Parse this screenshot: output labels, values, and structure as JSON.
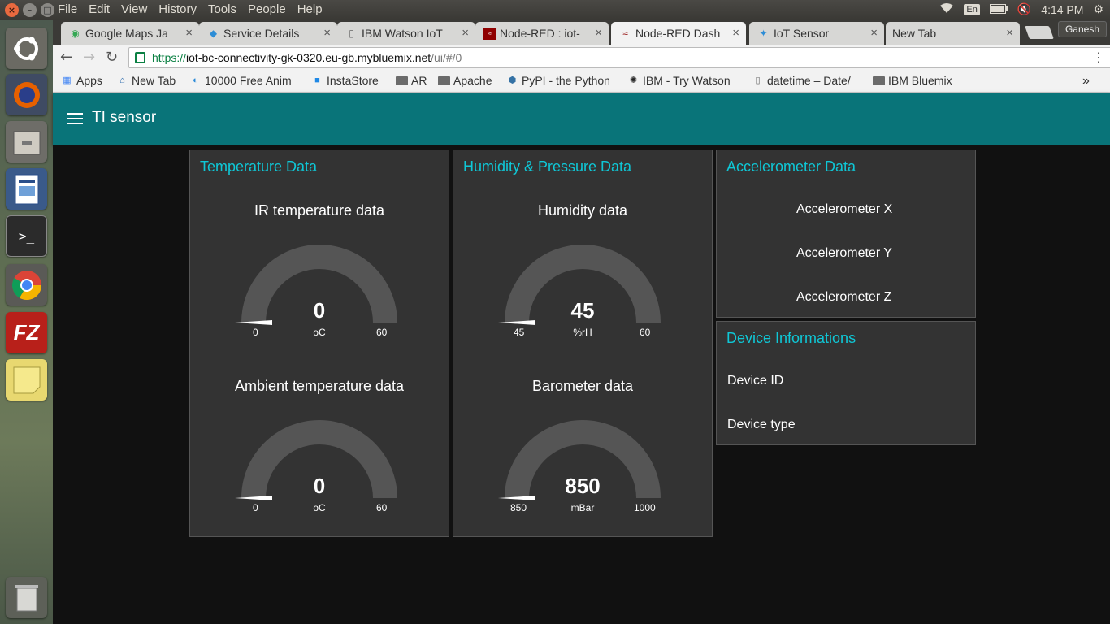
{
  "system": {
    "menus": [
      "File",
      "Edit",
      "View",
      "History",
      "Tools",
      "People",
      "Help"
    ],
    "language": "En",
    "time": "4:14 PM",
    "profile": "Ganesh"
  },
  "tabs": [
    {
      "label": "Google Maps Ja",
      "icon": "google-maps-icon"
    },
    {
      "label": "Service Details",
      "icon": "bluemix-icon"
    },
    {
      "label": "IBM Watson IoT",
      "icon": "page-icon"
    },
    {
      "label": "Node-RED : iot-",
      "icon": "node-red-icon"
    },
    {
      "label": "Node-RED Dash",
      "icon": "node-red-icon"
    },
    {
      "label": "IoT Sensor",
      "icon": "iot-icon"
    },
    {
      "label": "New Tab",
      "icon": ""
    }
  ],
  "omnibox": {
    "scheme": "https://",
    "host": "iot-bc-connectivity-gk-0320.eu-gb.mybluemix.net",
    "path": "/ui/#/0"
  },
  "bookmarks": [
    {
      "label": "Apps"
    },
    {
      "label": "New Tab"
    },
    {
      "label": "10000 Free Anim"
    },
    {
      "label": "InstaStore"
    },
    {
      "label": "AR"
    },
    {
      "label": "Apache"
    },
    {
      "label": "PyPI - the Python"
    },
    {
      "label": "IBM - Try Watson"
    },
    {
      "label": "datetime – Date/"
    },
    {
      "label": "IBM Bluemix"
    }
  ],
  "dashboard": {
    "title": "TI sensor",
    "accent": "#0fc7d6",
    "header_color": "#097479",
    "temperature": {
      "title": "Temperature Data",
      "ir": {
        "label": "IR temperature data",
        "value": "0",
        "unit": "oC",
        "min": "0",
        "max": "60",
        "level": 0
      },
      "ambient": {
        "label": "Ambient temperature data",
        "value": "0",
        "unit": "oC",
        "min": "0",
        "max": "60",
        "level": 0
      }
    },
    "humidity": {
      "title": "Humidity & Pressure Data",
      "humidity": {
        "label": "Humidity data",
        "value": "45",
        "unit": "%rH",
        "min": "45",
        "max": "60",
        "level": 0
      },
      "barometer": {
        "label": "Barometer data",
        "value": "850",
        "unit": "mBar",
        "min": "850",
        "max": "1000",
        "level": 0
      }
    },
    "accelerometer": {
      "title": "Accelerometer Data",
      "x": "Accelerometer X",
      "y": "Accelerometer Y",
      "z": "Accelerometer Z"
    },
    "device": {
      "title": "Device Informations",
      "id": "Device ID",
      "type": "Device type"
    }
  }
}
